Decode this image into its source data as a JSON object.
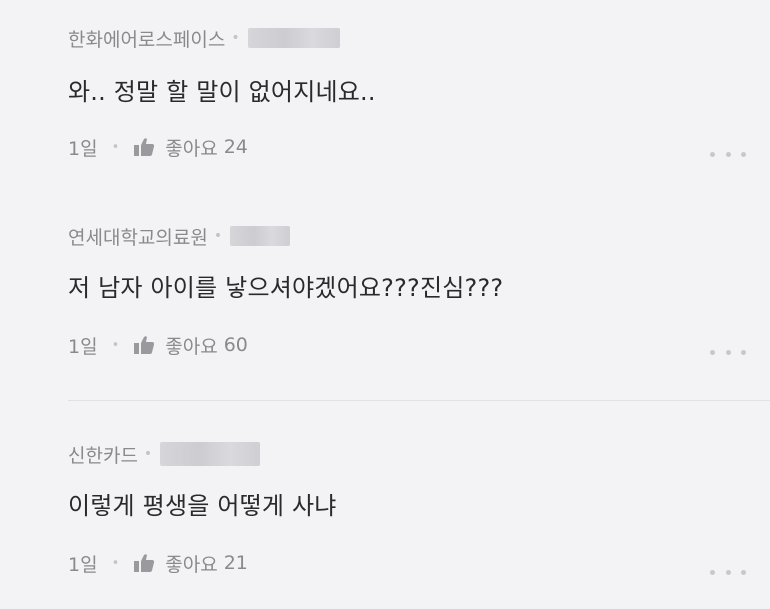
{
  "comments": [
    {
      "company": "한화에어로스페이스",
      "text": "와.. 정말 할 말이 없어지네요..",
      "time": "1일",
      "like_label": "좋아요",
      "like_count": "24"
    },
    {
      "company": "연세대학교의료원",
      "text": "저 남자 아이를 낳으셔야겠어요???진심???",
      "time": "1일",
      "like_label": "좋아요",
      "like_count": "60"
    },
    {
      "company": "신한카드",
      "text": "이렇게 평생을 어떻게 사냐",
      "time": "1일",
      "like_label": "좋아요",
      "like_count": "21"
    }
  ],
  "icons": {
    "like": "thumbs-up-icon",
    "more": "more-options-icon"
  },
  "colors": {
    "background": "#f3f3f5",
    "meta_text": "#8a8a8e",
    "body_text": "#2a2a2c",
    "icon": "#9a9a9e"
  }
}
